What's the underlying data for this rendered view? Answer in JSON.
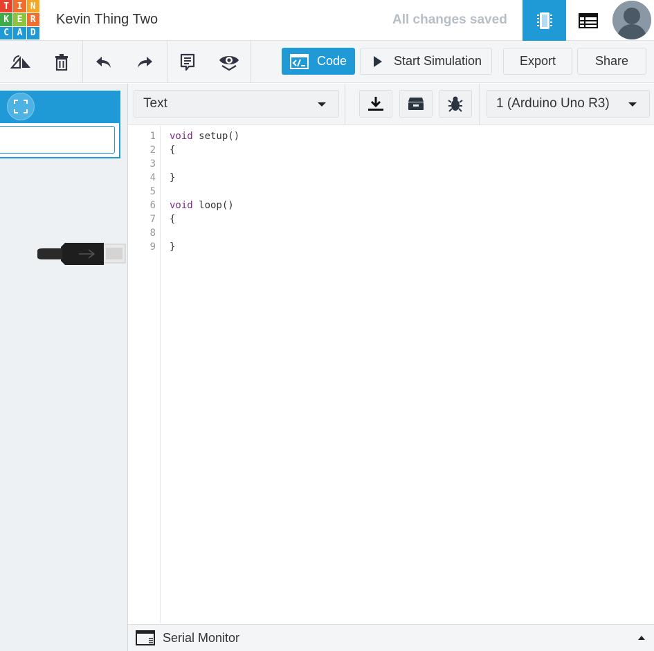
{
  "logo": {
    "letters": [
      "T",
      "I",
      "N",
      "K",
      "E",
      "R",
      "C",
      "A",
      "D"
    ],
    "colors": [
      "#e5412d",
      "#f06f2e",
      "#f5a623",
      "#3faa4c",
      "#8cc43e",
      "#f06f2e",
      "#1f9ad6",
      "#1f9ad6",
      "#1f9ad6"
    ]
  },
  "header": {
    "project_title": "Kevin Thing Two",
    "save_status": "All changes saved",
    "circuit_view_icon": "breadboard-icon",
    "component_list_icon": "table-list-icon",
    "avatar_icon": "user-avatar"
  },
  "toolbar": {
    "rotate_icon": "rotate-icon",
    "delete_icon": "trash-icon",
    "undo_icon": "undo-icon",
    "redo_icon": "redo-icon",
    "notes_icon": "notes-icon",
    "view_icon": "eye-icon",
    "code_label": "Code",
    "start_simulation_label": "Start Simulation",
    "export_label": "Export",
    "share_label": "Share"
  },
  "code_toolbar": {
    "mode_value": "Text",
    "download_icon": "download-icon",
    "libraries_icon": "library-icon",
    "debug_icon": "bug-icon",
    "board_value": "1 (Arduino Uno R3)"
  },
  "editor": {
    "line_numbers": [
      "1",
      "2",
      "3",
      "4",
      "5",
      "6",
      "7",
      "8",
      "9"
    ],
    "lines": [
      {
        "kw": "void",
        "rest": " setup()"
      },
      {
        "kw": "",
        "rest": "{"
      },
      {
        "kw": "",
        "rest": ""
      },
      {
        "kw": "",
        "rest": "}"
      },
      {
        "kw": "",
        "rest": ""
      },
      {
        "kw": "void",
        "rest": " loop()"
      },
      {
        "kw": "",
        "rest": "{"
      },
      {
        "kw": "",
        "rest": ""
      },
      {
        "kw": "",
        "rest": "}"
      }
    ]
  },
  "serial_monitor": {
    "label": "Serial Monitor",
    "icon": "serial-window-icon"
  },
  "colors": {
    "accent": "#1f9ad6",
    "keyword": "#7a2a8c"
  }
}
